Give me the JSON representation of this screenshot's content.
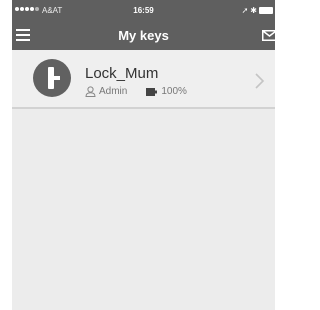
{
  "status_bar": {
    "carrier": "A&AT",
    "time": "16:59"
  },
  "header": {
    "title": "My keys",
    "menu_icon": "hamburger-menu-icon",
    "right_icon": "mail-icon"
  },
  "keys": [
    {
      "name": "Lock_Mum",
      "role": "Admin",
      "battery": "100%",
      "icon": "lock-icon"
    }
  ],
  "colors": {
    "header": "#5f5f5f",
    "background": "#ececec",
    "avatar": "#616161"
  }
}
